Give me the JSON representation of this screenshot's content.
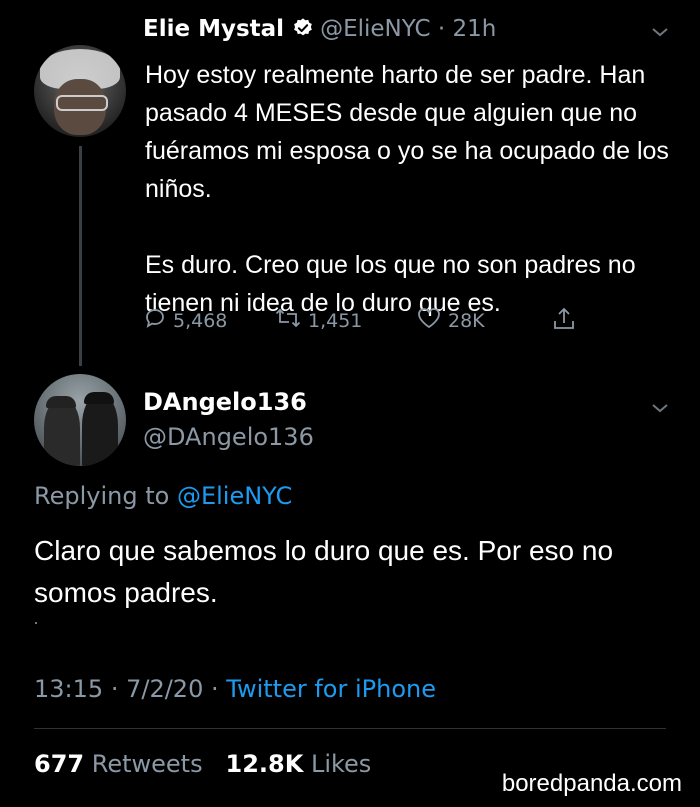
{
  "tweet_original": {
    "name": "Elie Mystal",
    "handle": "@ElieNYC",
    "time_sep": "·",
    "time": "21h",
    "body_p1": "Hoy estoy realmente harto de ser padre. Han pasado 4 MESES desde que alguien que no fuéramos mi esposa o yo se ha ocupado de los niños.",
    "body_p2": "Es duro. Creo que los que no son padres no tienen ni idea de lo duro que es.",
    "replies": "5,468",
    "retweets": "1,451",
    "likes": "28K"
  },
  "tweet_reply": {
    "name": "DAngelo136",
    "handle": "@DAngelo136",
    "replying_label": "Replying to",
    "replying_handle": "@ElieNYC",
    "body": "Claro que sabemos lo duro que es. Por eso no somos padres.",
    "time": "13:15",
    "date": "7/2/20",
    "sep": "·",
    "client": "Twitter for iPhone",
    "retweet_count": "677",
    "retweet_label": "Retweets",
    "like_count": "12.8K",
    "like_label": "Likes"
  },
  "watermark": "boredpanda.com",
  "colors": {
    "accent": "#1d9bf0",
    "muted": "#8b98a5",
    "background": "#000000"
  },
  "icons": [
    "verified-badge-icon",
    "chevron-down-icon",
    "reply-icon",
    "retweet-icon",
    "like-icon",
    "share-icon"
  ]
}
